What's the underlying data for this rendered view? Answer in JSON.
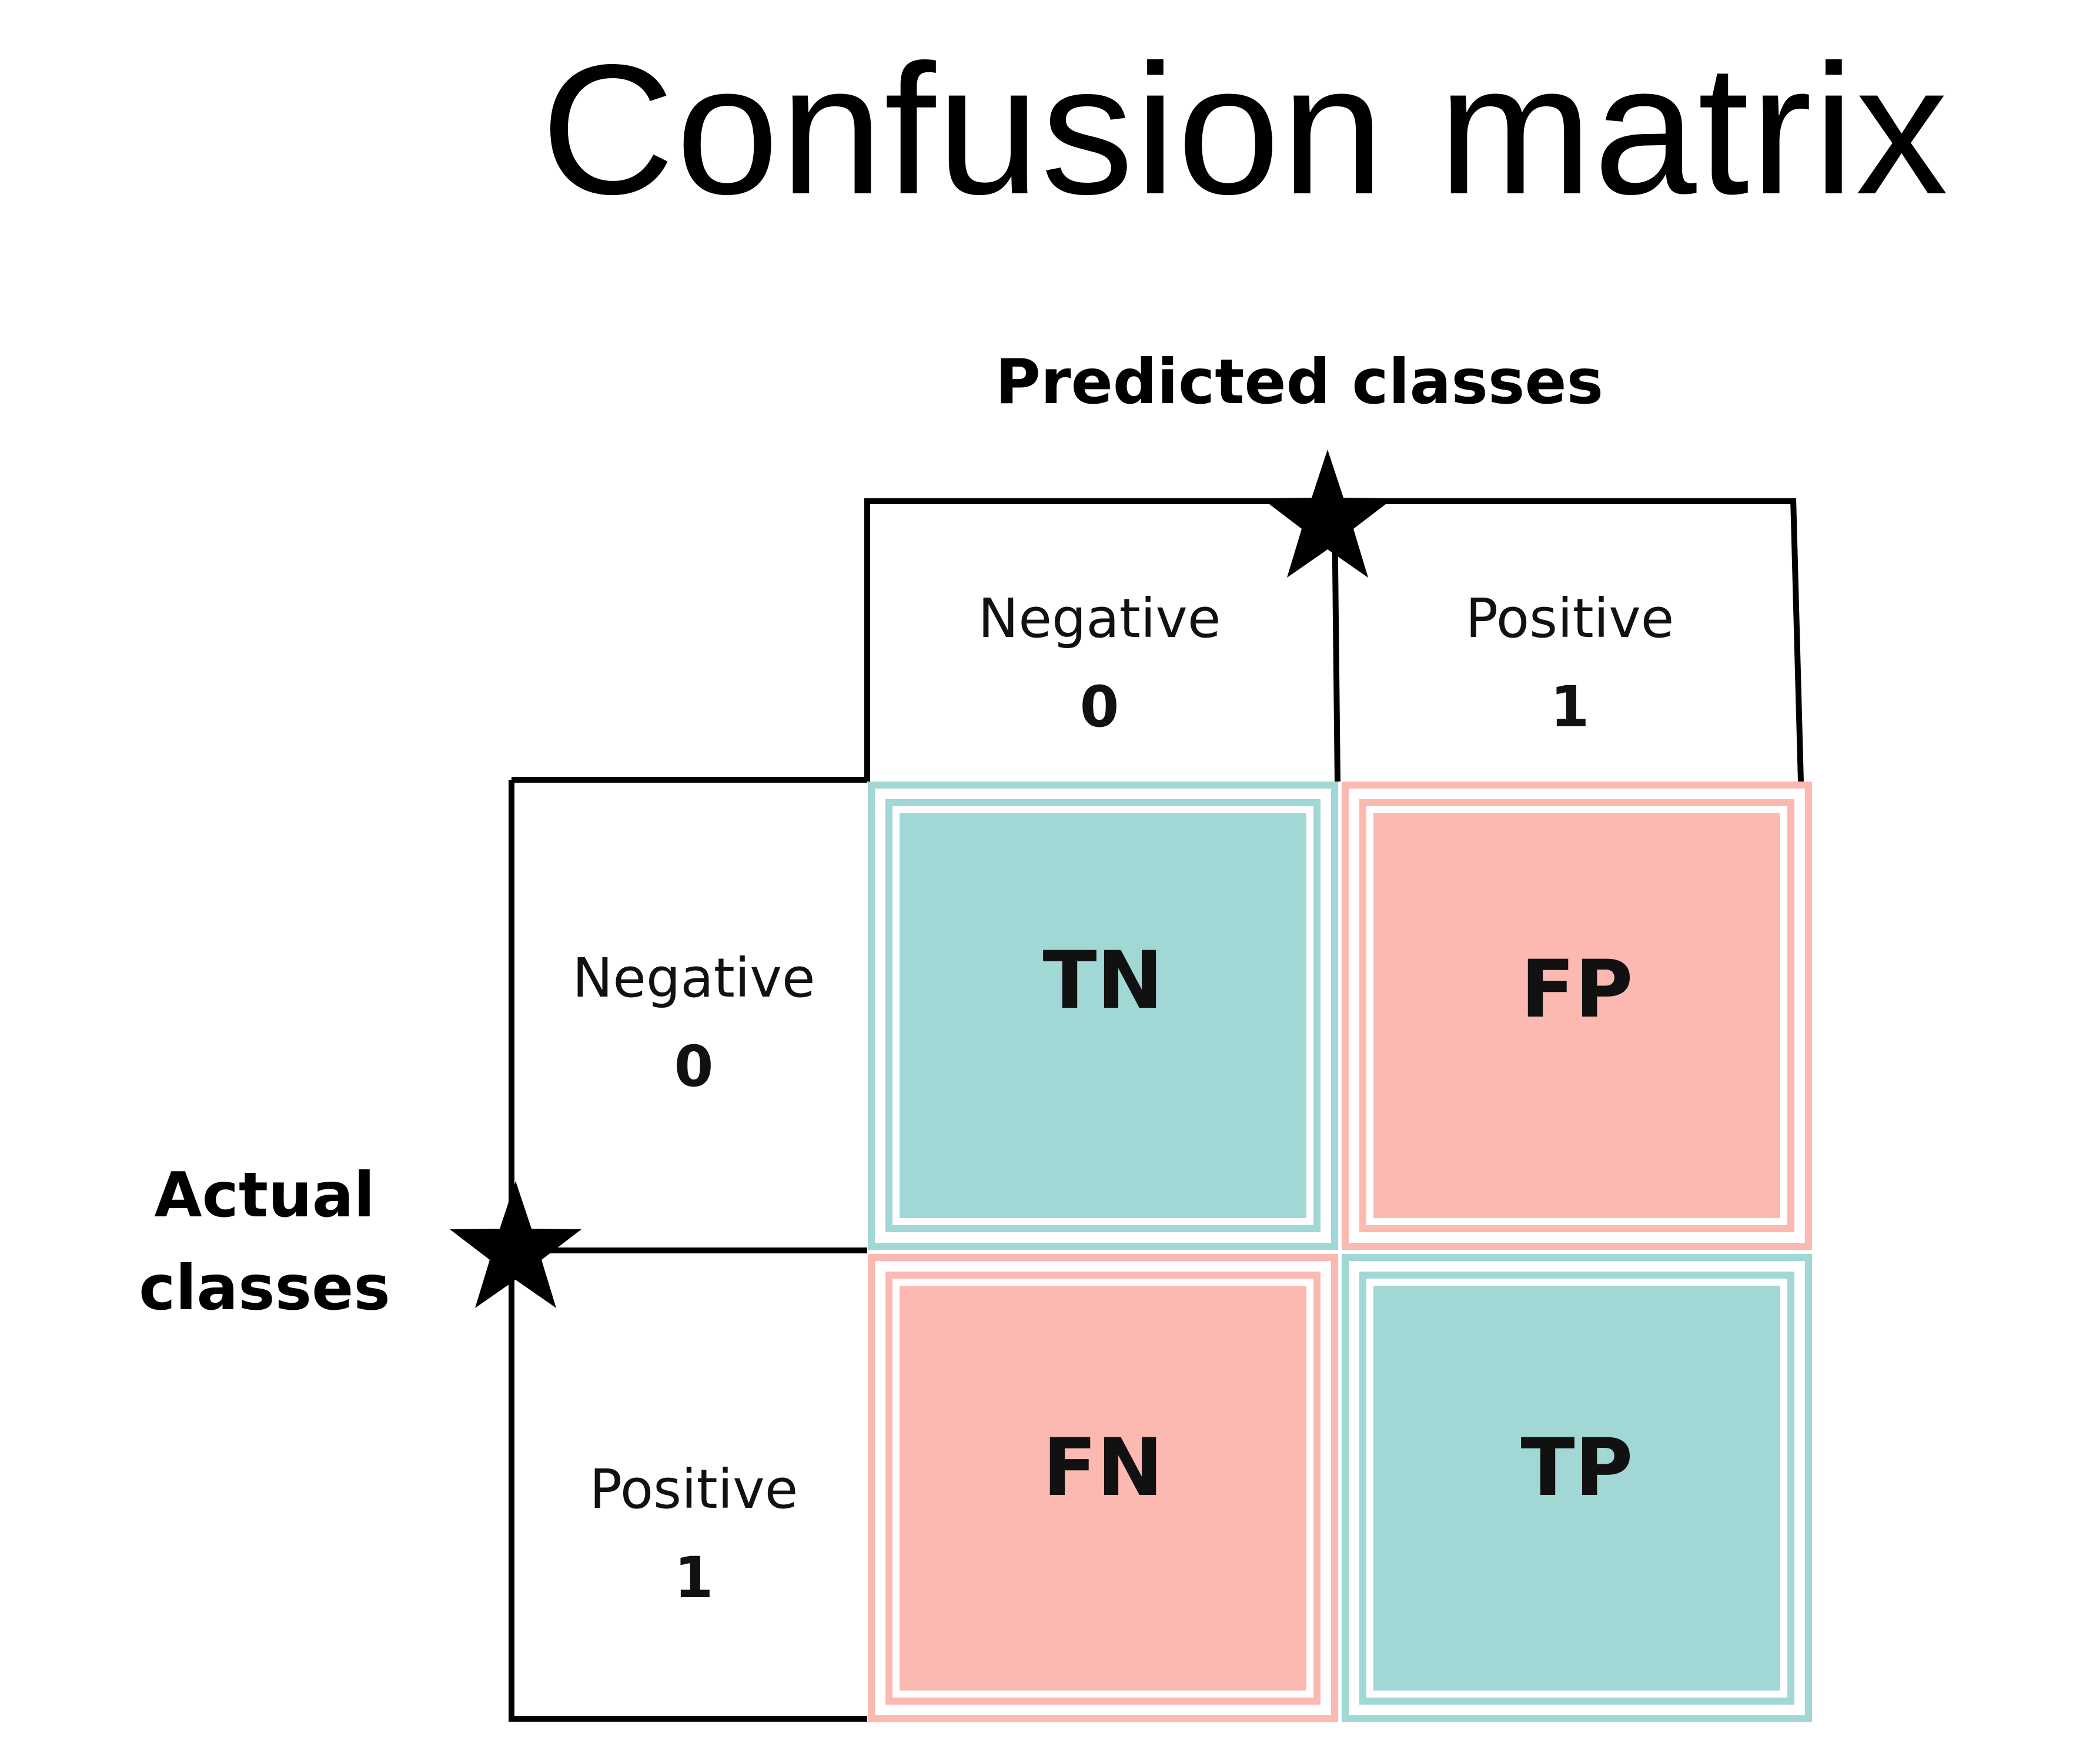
{
  "title": "Confusion matrix",
  "predicted_axis": {
    "title": "Predicted classes",
    "classes": [
      {
        "name": "Negative",
        "code": "0"
      },
      {
        "name": "Positive",
        "code": "1"
      }
    ]
  },
  "actual_axis": {
    "title_line1": "Actual",
    "title_line2": "classes",
    "classes": [
      {
        "name": "Negative",
        "code": "0"
      },
      {
        "name": "Positive",
        "code": "1"
      }
    ]
  },
  "matrix": [
    [
      {
        "label": "TN",
        "kind": "correct"
      },
      {
        "label": "FP",
        "kind": "error"
      }
    ],
    [
      {
        "label": "FN",
        "kind": "error"
      },
      {
        "label": "TP",
        "kind": "correct"
      }
    ]
  ],
  "colors": {
    "correct_fill": "#a1d7d4",
    "error_fill": "#fbb9b1",
    "correct_border": "#a1d7d4",
    "error_border": "#fbb9b1",
    "line": "#000000",
    "text": "#111111"
  },
  "icons": {
    "axis_marker": "star-icon"
  }
}
